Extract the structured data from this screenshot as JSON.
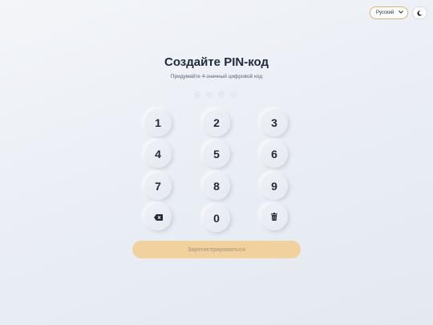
{
  "header": {
    "language": "Русский",
    "language_options": [
      "Русский"
    ],
    "theme_icon": "moon-icon"
  },
  "main": {
    "title": "Создайте PIN-код",
    "subtitle": "Придумайте 4-значный цифровой код",
    "pin_length": 4,
    "pin_filled": 0
  },
  "keypad": {
    "keys": [
      "1",
      "2",
      "3",
      "4",
      "5",
      "6",
      "7",
      "8",
      "9",
      "0"
    ],
    "backspace_icon": "backspace-icon",
    "clear_icon": "trash-icon"
  },
  "actions": {
    "register_label": "Зарегистрироваться",
    "register_disabled": true
  },
  "colors": {
    "accent": "#f1d29c",
    "accent_border": "#d9b56c",
    "text": "#1e293b"
  }
}
